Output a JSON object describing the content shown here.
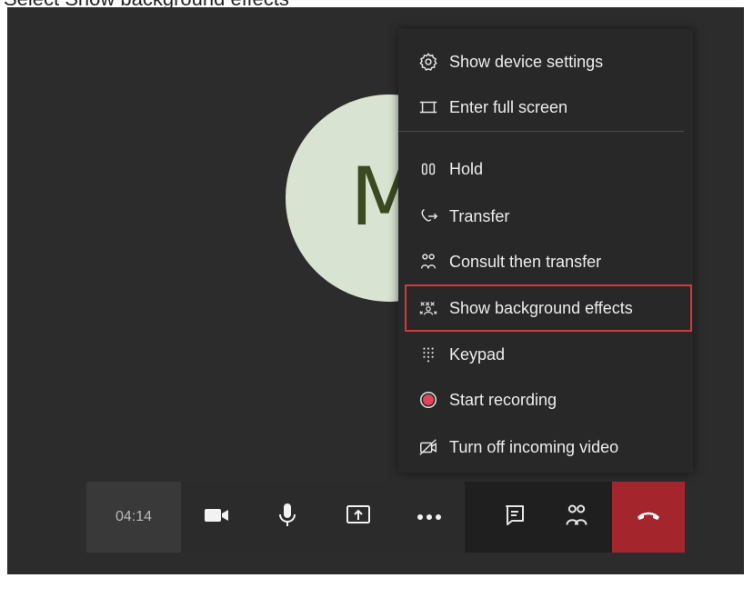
{
  "caption": "Select Show background effects",
  "avatar": {
    "initial": "M",
    "bg": "#d9e3d1",
    "fg": "#3b4a22"
  },
  "menu": {
    "items": [
      {
        "label": "Show device settings",
        "icon": "gear-icon"
      },
      {
        "label": "Enter full screen",
        "icon": "full-screen-icon"
      },
      {
        "label": "Hold",
        "icon": "hold-icon"
      },
      {
        "label": "Transfer",
        "icon": "transfer-icon"
      },
      {
        "label": "Consult then transfer",
        "icon": "consult-transfer-icon"
      },
      {
        "label": "Show background effects",
        "icon": "background-effects-icon",
        "highlighted": true
      },
      {
        "label": "Keypad",
        "icon": "keypad-icon"
      },
      {
        "label": "Start recording",
        "icon": "record-icon"
      },
      {
        "label": "Turn off incoming video",
        "icon": "video-off-icon"
      }
    ]
  },
  "controls": {
    "timer": "04:14",
    "buttons": [
      "camera-icon",
      "microphone-icon",
      "share-screen-icon",
      "more-options-icon",
      "chat-icon",
      "participants-icon",
      "hang-up-icon"
    ]
  },
  "colors": {
    "stage_bg": "#2d2c2c",
    "menu_bg": "#292828",
    "highlight_border": "#d0393d",
    "hangup_bg": "#a4262c",
    "record_dot": "#e0455a"
  }
}
